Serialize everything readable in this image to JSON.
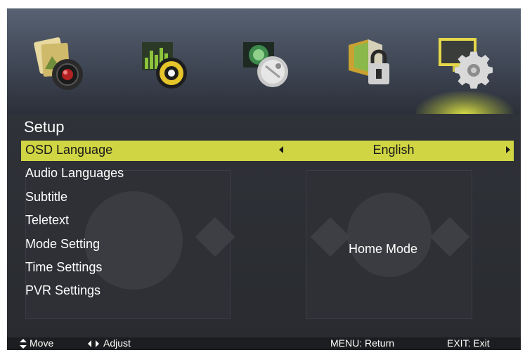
{
  "tabs": [
    {
      "icon": "picture-icon"
    },
    {
      "icon": "sound-icon"
    },
    {
      "icon": "channel-icon"
    },
    {
      "icon": "lock-icon"
    },
    {
      "icon": "setup-icon",
      "active": true
    }
  ],
  "page_title": "Setup",
  "menu": [
    {
      "label": "OSD Language",
      "value": "English",
      "selected": true
    },
    {
      "label": "Audio Languages"
    },
    {
      "label": "Subtitle"
    },
    {
      "label": "Teletext"
    },
    {
      "label": "Mode Setting",
      "value": "Home Mode"
    },
    {
      "label": "Time Settings"
    },
    {
      "label": "PVR Settings"
    }
  ],
  "footer": {
    "move": "Move",
    "adjust": "Adjust",
    "menu_return": "MENU: Return",
    "exit": "EXIT: Exit"
  },
  "colors": {
    "highlight": "#d0d543",
    "background": "#222427"
  }
}
